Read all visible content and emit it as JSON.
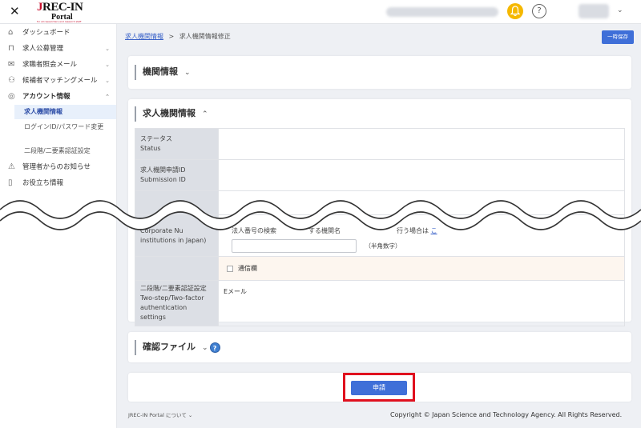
{
  "header": {
    "close_label": "✕",
    "logo": {
      "line1_j": "J",
      "line1_rest": "REC-IN",
      "line2": "Portal",
      "tagline": "for all researchers and research staff"
    },
    "help_label": "?",
    "user_chevron": "⌄"
  },
  "sidebar": {
    "items": [
      {
        "label": "ダッシュボード",
        "icon": "home-icon",
        "glyph": "⌂",
        "chevron": ""
      },
      {
        "label": "求人公募管理",
        "icon": "board-icon",
        "glyph": "⊓",
        "chevron": "⌄"
      },
      {
        "label": "求職者照会メール",
        "icon": "mail-icon",
        "glyph": "✉",
        "chevron": "⌄"
      },
      {
        "label": "候補者マッチングメール",
        "icon": "people-icon",
        "glyph": "⚇",
        "chevron": "⌄"
      },
      {
        "label": "アカウント情報",
        "icon": "account-icon",
        "glyph": "◎",
        "chevron": "⌃"
      }
    ],
    "subitems": [
      {
        "label": "求人機関情報",
        "active": true
      },
      {
        "label": "ログインID/パスワード変更",
        "active": false
      },
      {
        "label": "二段階/二要素認証設定",
        "active": false
      }
    ],
    "bottom_items": [
      {
        "label": "管理者からのお知らせ",
        "icon": "warning-icon",
        "glyph": "⚠"
      },
      {
        "label": "お役立ち情報",
        "icon": "book-icon",
        "glyph": "▯"
      }
    ]
  },
  "breadcrumb": {
    "link": "求人機関情報",
    "sep": ">",
    "current": "求人機関情報修正"
  },
  "save_button": "一時保存",
  "section1": {
    "title": "機関情報",
    "chevron": "⌄"
  },
  "section2": {
    "title": "求人機関情報",
    "chevron": "⌃",
    "rows": [
      {
        "label_ja": "ステータス",
        "label_en": "Status",
        "value": ""
      },
      {
        "label_ja": "求人機関申請ID",
        "label_en": "Submission ID",
        "value": ""
      },
      {
        "label_ja": "",
        "label_en": "",
        "value": ""
      }
    ],
    "corp": {
      "label_a": "Corporate Nu",
      "label_b": "institutions in Japan)",
      "text_a": "法人番号の検索",
      "text_b": "する機関名",
      "text_c": "行う場合は",
      "unit_note": "（半角数字）"
    },
    "comm_label": "通信欄",
    "twofa": {
      "label_ja": "二段階/二要素認証設定",
      "label_en": "Two-step/Two-factor authentication settings",
      "value": "Eメール"
    }
  },
  "section3": {
    "title": "確認ファイル",
    "chevron": "⌄",
    "help": "?"
  },
  "apply_button": "申請",
  "footer": {
    "about": "JREC-IN Portal について ⌄",
    "copyright": "Copyright © Japan Science and Technology Agency. All Rights Reserved."
  },
  "colors": {
    "primary": "#3f6fd8",
    "highlight": "#e0101e",
    "bell": "#f5b800"
  }
}
